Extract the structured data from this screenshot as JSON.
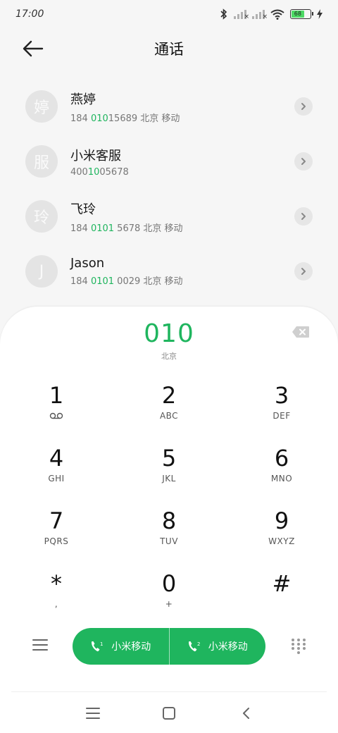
{
  "status_bar": {
    "time": "17:00",
    "battery_level": "68",
    "icons": [
      "bluetooth-icon",
      "signal-sim1-icon",
      "signal-sim2-icon",
      "wifi-icon",
      "battery-icon",
      "charging-icon"
    ]
  },
  "header": {
    "title": "通话",
    "back_icon": "arrow-left-icon"
  },
  "contacts": [
    {
      "avatar": "婷",
      "name": "燕婷",
      "number_pre": "184 ",
      "number_hl": "010",
      "number_post": "15689",
      "location": " 北京 移动"
    },
    {
      "avatar": "服",
      "name": "小米客服",
      "number_pre": "400",
      "number_hl": "10",
      "number_post": "05678",
      "location": ""
    },
    {
      "avatar": "玲",
      "name": "飞玲",
      "number_pre": "184 ",
      "number_hl": "0101",
      "number_post": " 5678",
      "location": " 北京 移动"
    },
    {
      "avatar": "J",
      "name": "Jason",
      "number_pre": "184 ",
      "number_hl": "0101",
      "number_post": " 0029",
      "location": " 北京 移动"
    }
  ],
  "dialer": {
    "number": "010",
    "location": "北京",
    "keys": [
      {
        "digit": "1",
        "letters": ""
      },
      {
        "digit": "2",
        "letters": "ABC"
      },
      {
        "digit": "3",
        "letters": "DEF"
      },
      {
        "digit": "4",
        "letters": "GHI"
      },
      {
        "digit": "5",
        "letters": "JKL"
      },
      {
        "digit": "6",
        "letters": "MNO"
      },
      {
        "digit": "7",
        "letters": "PQRS"
      },
      {
        "digit": "8",
        "letters": "TUV"
      },
      {
        "digit": "9",
        "letters": "WXYZ"
      },
      {
        "digit": "*",
        "letters": ","
      },
      {
        "digit": "0",
        "letters": "+"
      },
      {
        "digit": "#",
        "letters": ""
      }
    ],
    "call_sim1_label": "小米移动",
    "call_sim2_label": "小米移动",
    "sim1_badge": "1",
    "sim2_badge": "2"
  },
  "colors": {
    "accent": "#1fb55e",
    "background": "#f6f6f6",
    "panel": "#ffffff"
  }
}
